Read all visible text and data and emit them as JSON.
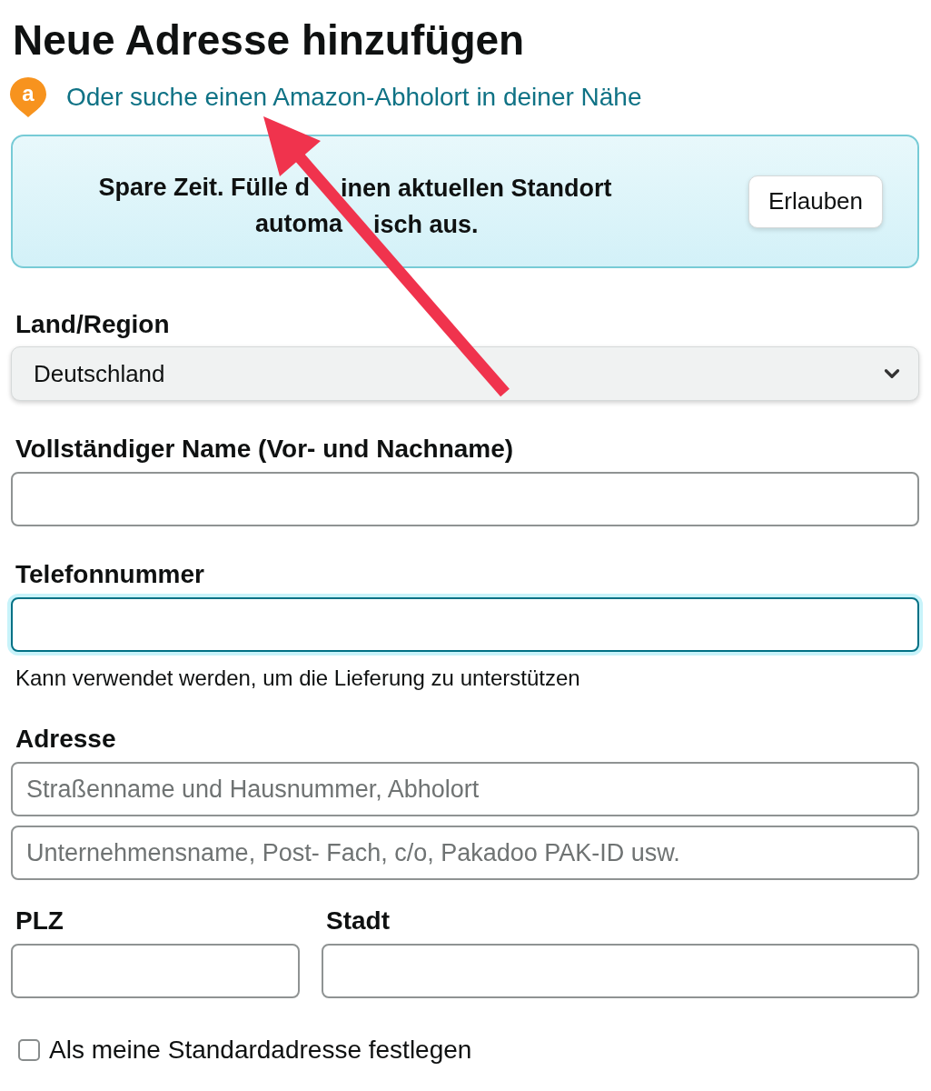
{
  "title": "Neue Adresse hinzufügen",
  "pickup_link": {
    "badge": "a",
    "text": "Oder suche einen Amazon-Abholort in deiner Nähe"
  },
  "location_banner": {
    "message_lines": [
      [
        "Spare Zeit. Fülle d",
        "inen aktuellen Standort"
      ],
      [
        "automa",
        "isch aus."
      ]
    ],
    "button": "Erlauben"
  },
  "fields": [
    {
      "kind": "select",
      "label": "Land/Region",
      "value": "Deutschland"
    },
    {
      "kind": "input",
      "label": "Vollständiger Name (Vor- und Nachname)",
      "focused": false
    },
    {
      "kind": "input",
      "label": "Telefonnummer",
      "focused": true,
      "hint": "Kann verwendet werden, um die Lieferung zu unterstützen"
    },
    {
      "kind": "stack",
      "label": "Adresse",
      "inputs": [
        {
          "placeholder": "Straßenname und Hausnummer, Abholort",
          "focused": false
        },
        {
          "placeholder": "Unternehmensname, Post- Fach, c/o, Pakadoo PAK-ID usw.",
          "focused": false
        }
      ]
    },
    {
      "kind": "split",
      "parts": [
        {
          "label": "PLZ",
          "focused": false
        },
        {
          "label": "Stadt",
          "focused": false
        }
      ]
    }
  ],
  "default_address": {
    "label": "Als meine Standardadresse festlegen",
    "checked": false
  }
}
